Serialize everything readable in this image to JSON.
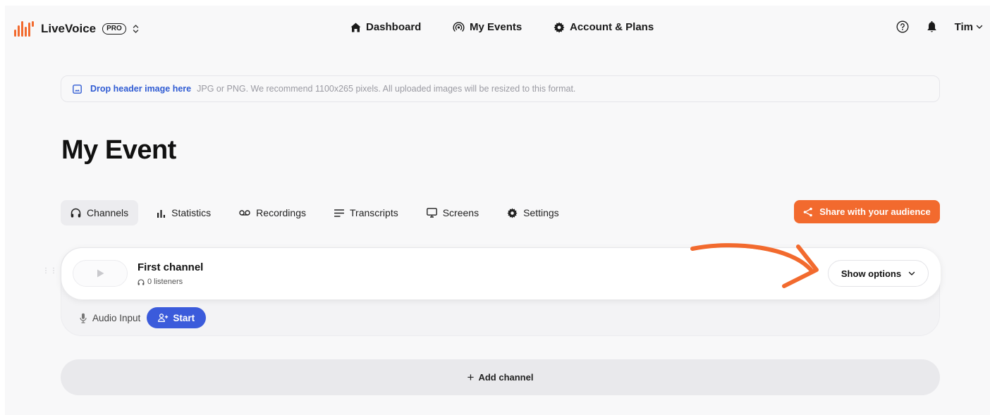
{
  "brand": {
    "name": "LiveVoice",
    "badge": "PRO",
    "switch_icon": "chevrons-up-down-icon",
    "accent": "#f26a2e"
  },
  "nav": [
    {
      "label": "Dashboard",
      "icon": "home-icon"
    },
    {
      "label": "My Events",
      "icon": "broadcast-icon"
    },
    {
      "label": "Account & Plans",
      "icon": "gear-icon"
    }
  ],
  "user": {
    "name": "Tim"
  },
  "dropzone": {
    "action": "Drop header image here",
    "hint": "JPG or PNG. We recommend 1100x265 pixels. All uploaded images will be resized to this format."
  },
  "page": {
    "title": "My Event"
  },
  "tabs": [
    {
      "label": "Channels",
      "icon": "headphones-icon",
      "active": true
    },
    {
      "label": "Statistics",
      "icon": "bar-chart-icon"
    },
    {
      "label": "Recordings",
      "icon": "voicemail-icon"
    },
    {
      "label": "Transcripts",
      "icon": "text-lines-icon"
    },
    {
      "label": "Screens",
      "icon": "monitor-icon"
    },
    {
      "label": "Settings",
      "icon": "gear-icon"
    }
  ],
  "share": {
    "label": "Share with your audience",
    "color": "#f26a2e"
  },
  "channel": {
    "name": "First channel",
    "listeners": "0 listeners",
    "options_label": "Show options",
    "audio_label": "Audio Input",
    "start_label": "Start",
    "start_color": "#3b5bdb"
  },
  "add_channel": {
    "label": "Add channel"
  }
}
